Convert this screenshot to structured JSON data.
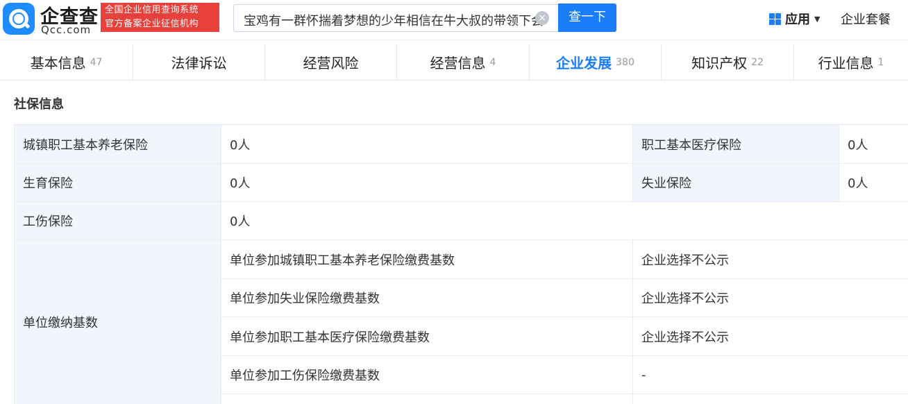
{
  "header": {
    "brand_name": "企查查",
    "brand_sub": "Qcc.com",
    "badge_line1": "全国企业信用查询系统",
    "badge_line2": "官方备案企业征信机构",
    "search_value": "宝鸡有一群怀揣着梦想的少年相信在牛大叔的带领下会",
    "search_button": "查一下",
    "apps_label": "应用",
    "plan_label": "企业套餐"
  },
  "tabs": [
    {
      "label": "基本信息",
      "count": "47"
    },
    {
      "label": "法律诉讼",
      "count": ""
    },
    {
      "label": "经营风险",
      "count": ""
    },
    {
      "label": "经营信息",
      "count": "4"
    },
    {
      "label": "企业发展",
      "count": "380"
    },
    {
      "label": "知识产权",
      "count": "22"
    },
    {
      "label": "行业信息",
      "count": "1"
    }
  ],
  "section": {
    "title": "社保信息"
  },
  "social_security": {
    "pension_label": "城镇职工基本养老保险",
    "pension_value": "0人",
    "medical_label": "职工基本医疗保险",
    "medical_value": "0人",
    "maternity_label": "生育保险",
    "maternity_value": "0人",
    "unemployment_label": "失业保险",
    "unemployment_value": "0人",
    "injury_label": "工伤保险",
    "injury_value": "0人",
    "base_label": "单位缴纳基数",
    "base_rows": [
      {
        "label": "单位参加城镇职工基本养老保险缴费基数",
        "value": "企业选择不公示"
      },
      {
        "label": "单位参加失业保险缴费基数",
        "value": "企业选择不公示"
      },
      {
        "label": "单位参加职工基本医疗保险缴费基数",
        "value": "企业选择不公示"
      },
      {
        "label": "单位参加工伤保险缴费基数",
        "value": "-"
      }
    ]
  }
}
